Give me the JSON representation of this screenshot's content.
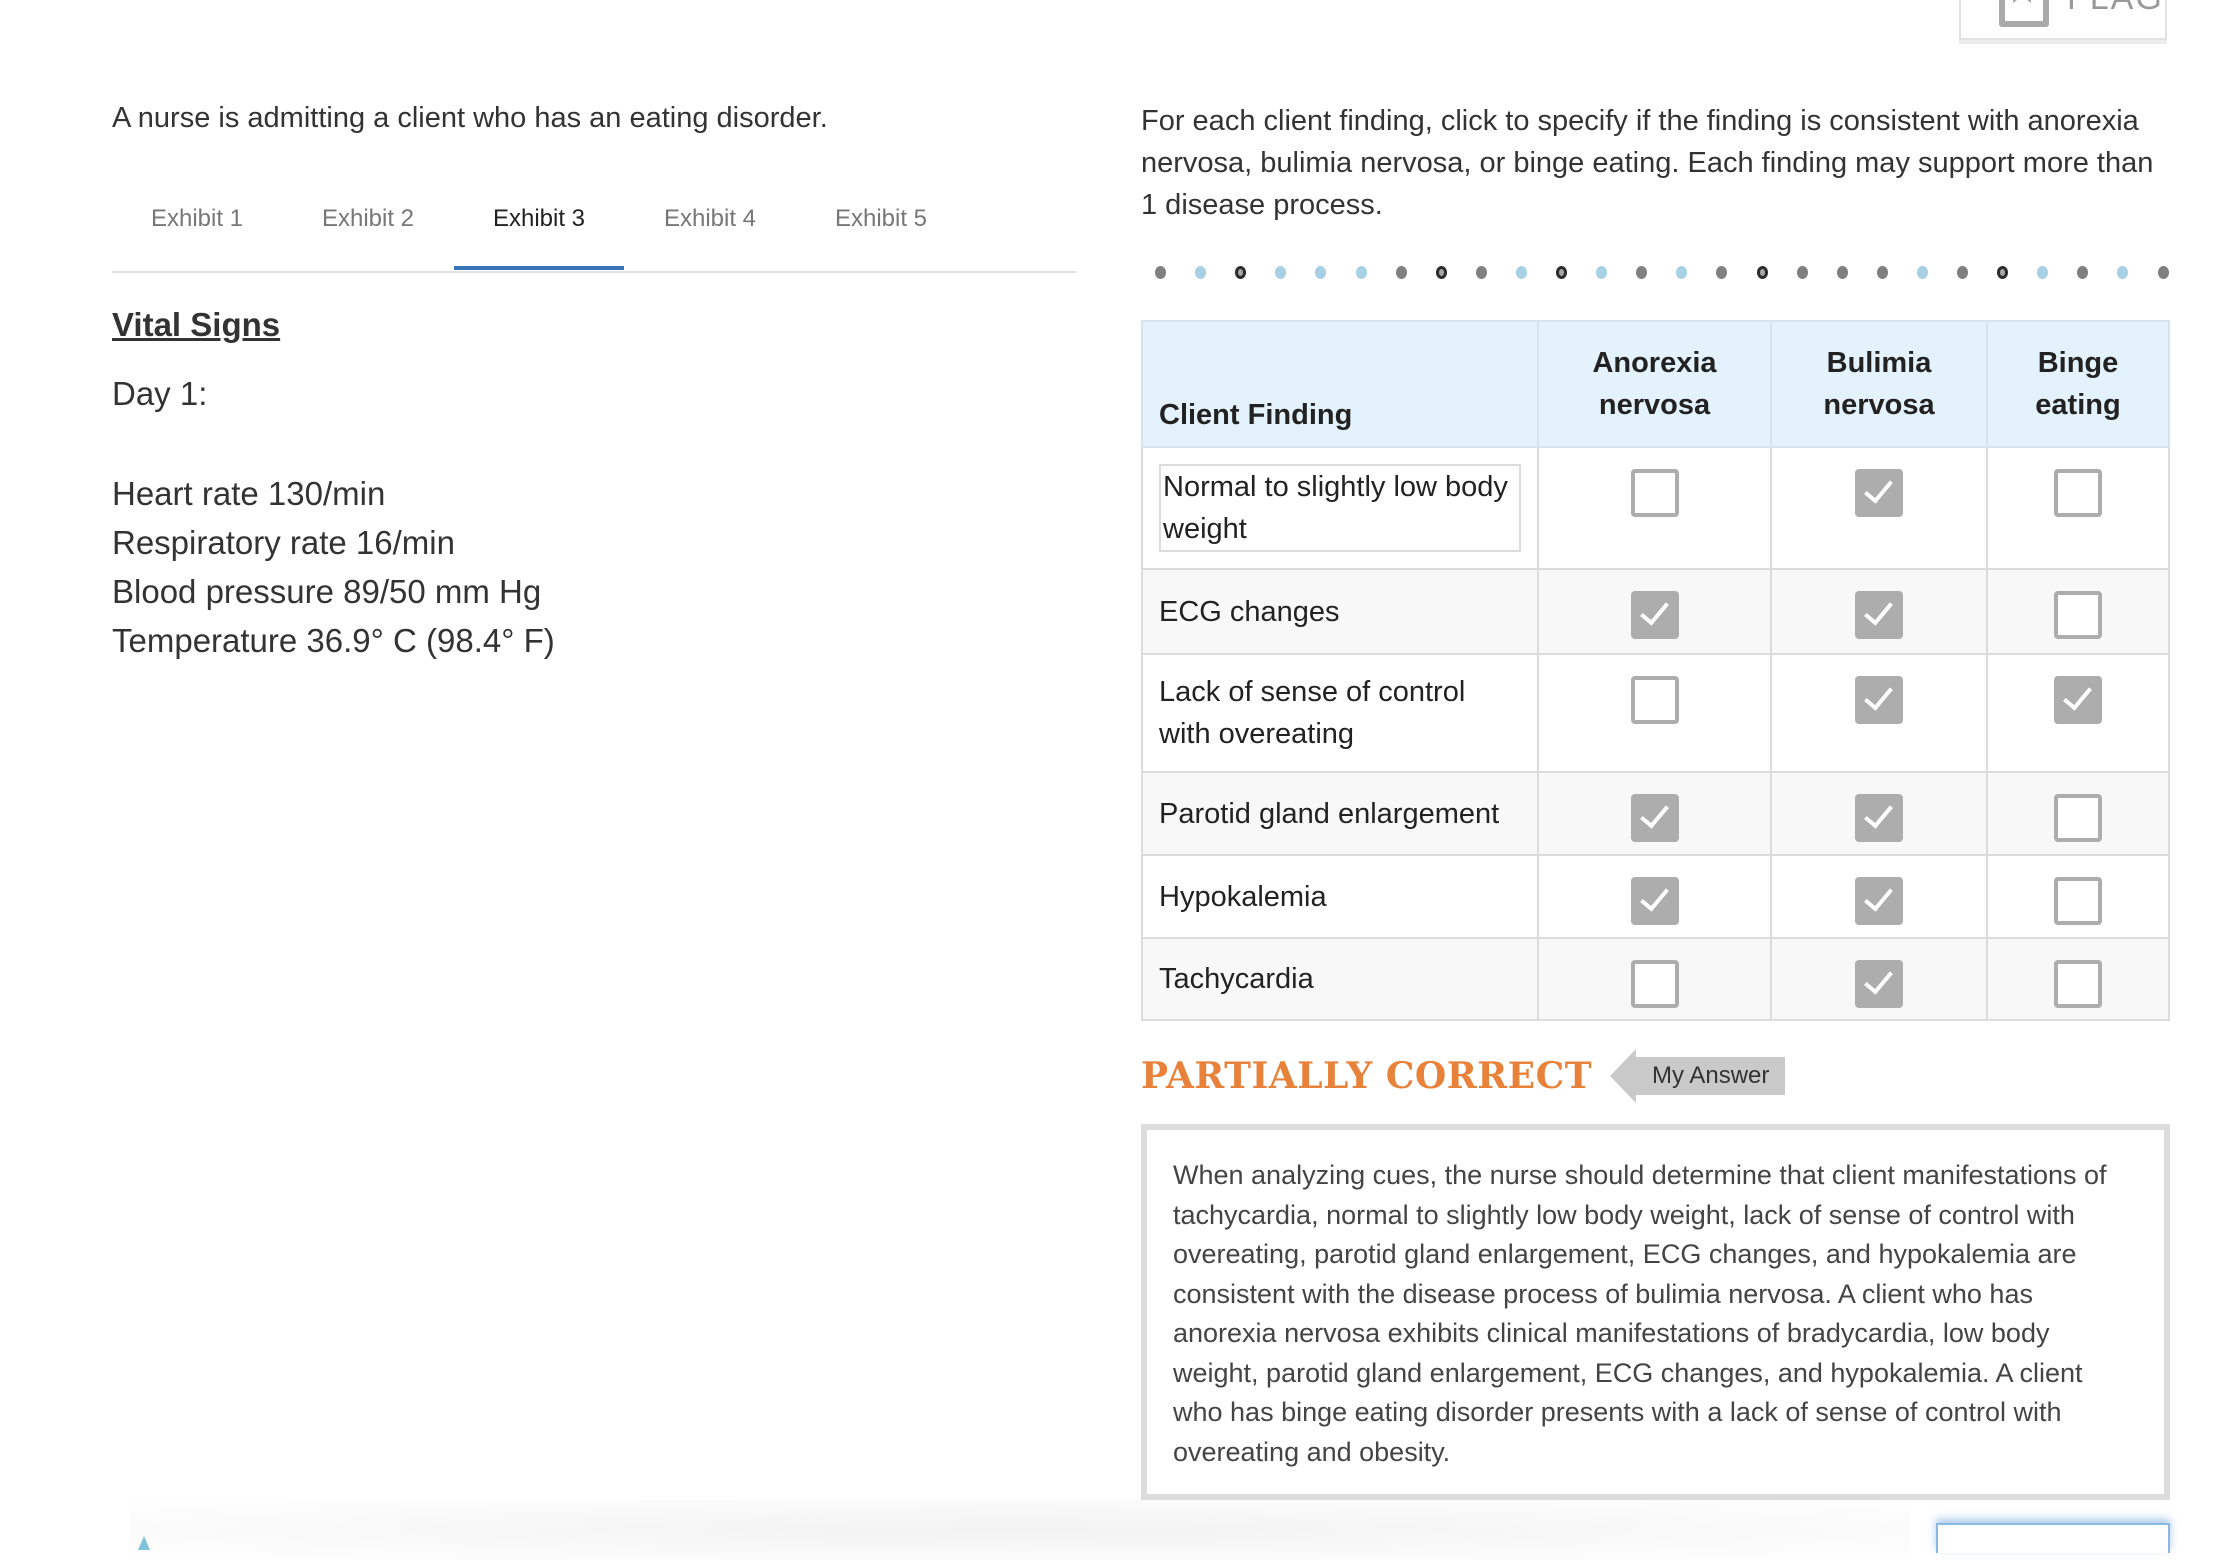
{
  "flag": {
    "label": "FLAG",
    "icon": "bookmark-icon"
  },
  "stem": "A nurse is admitting a client who has an eating disorder.",
  "tabs": [
    {
      "label": "Exhibit 1",
      "active": false
    },
    {
      "label": "Exhibit 2",
      "active": false
    },
    {
      "label": "Exhibit 3",
      "active": true
    },
    {
      "label": "Exhibit 4",
      "active": false
    },
    {
      "label": "Exhibit 5",
      "active": false
    }
  ],
  "exhibit": {
    "title": "Vital Signs",
    "day": "Day 1:",
    "vitals": [
      "Heart rate 130/min",
      "Respiratory rate 16/min",
      "Blood pressure 89/50 mm Hg",
      "Temperature 36.9° C (98.4° F)"
    ]
  },
  "instructions": "For each client finding, click to specify if the finding is consistent with anorexia nervosa, bulimia nervosa, or binge eating. Each finding may support more than 1 disease process.",
  "progress_dots": [
    "gray",
    "blue",
    "ring",
    "blue",
    "blue",
    "blue",
    "gray",
    "ring",
    "gray",
    "blue",
    "ring",
    "blue",
    "gray",
    "blue",
    "gray",
    "ring",
    "gray",
    "gray",
    "gray",
    "blue",
    "gray",
    "ring",
    "blue",
    "gray",
    "blue",
    "gray"
  ],
  "colors": {
    "accent_blue": "#3a74b8",
    "header_bg": "#e3f2fc",
    "result_orange": "#e8823a",
    "checkbox_gray": "#adadad"
  },
  "matrix": {
    "headers": {
      "finding": "Client Finding",
      "anorexia_line1": "Anorexia",
      "anorexia_line2": "nervosa",
      "bulimia_line1": "Bulimia",
      "bulimia_line2": "nervosa",
      "binge_line1": "Binge",
      "binge_line2": "eating"
    },
    "rows": [
      {
        "finding": "Normal to slightly low body weight",
        "anorexia": false,
        "bulimia": true,
        "binge": false
      },
      {
        "finding": "ECG changes",
        "anorexia": true,
        "bulimia": true,
        "binge": false
      },
      {
        "finding": "Lack of sense of control with overeating",
        "anorexia": false,
        "bulimia": true,
        "binge": true
      },
      {
        "finding": "Parotid gland enlargement",
        "anorexia": true,
        "bulimia": true,
        "binge": false
      },
      {
        "finding": "Hypokalemia",
        "anorexia": true,
        "bulimia": true,
        "binge": false
      },
      {
        "finding": "Tachycardia",
        "anorexia": false,
        "bulimia": true,
        "binge": false
      }
    ]
  },
  "result": {
    "label": "PARTIALLY CORRECT",
    "my_answer_label": "My Answer"
  },
  "explanation": "When analyzing cues, the nurse should determine that client manifestations of tachycardia, normal to slightly low body weight, lack of sense of control with overeating, parotid gland enlargement, ECG changes, and hypokalemia are consistent with the disease process of bulimia nervosa. A client who has anorexia nervosa exhibits clinical manifestations of bradycardia, low body weight, parotid gland enlargement, ECG changes, and hypokalemia. A client who has binge eating disorder presents with a lack of sense of control with overeating and obesity."
}
